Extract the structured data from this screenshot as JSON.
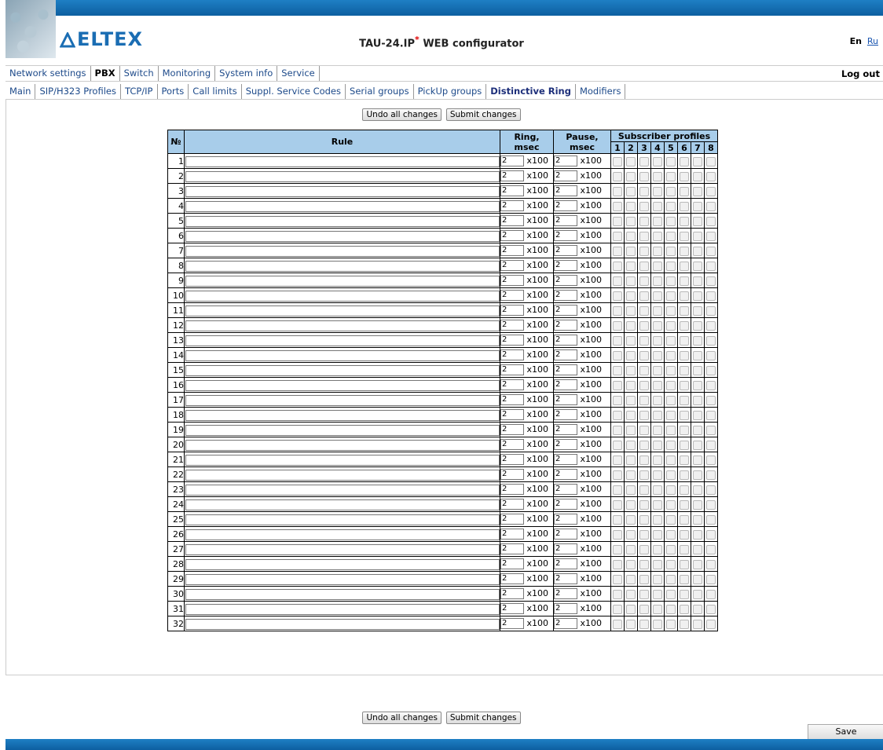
{
  "header": {
    "logo_text": "ELTEX",
    "title": "TAU-24.IP",
    "title_mark": "*",
    "title_suffix": " WEB configurator",
    "lang_en": "En",
    "lang_ru": "Ru"
  },
  "menu": {
    "items": [
      "Network settings",
      "PBX",
      "Switch",
      "Monitoring",
      "System info",
      "Service"
    ],
    "logout": "Log out"
  },
  "submenu": {
    "items": [
      "Main",
      "SIP/H323 Profiles",
      "TCP/IP",
      "Ports",
      "Call limits",
      "Suppl. Service Codes",
      "Serial groups",
      "PickUp groups",
      "Distinctive Ring",
      "Modifiers"
    ]
  },
  "buttons": {
    "undo": "Undo all changes",
    "submit": "Submit changes",
    "save": "Save"
  },
  "table": {
    "col_num": "№",
    "col_rule": "Rule",
    "col_ring": "Ring, msec",
    "col_pause": "Pause, msec",
    "col_profiles": "Subscriber profiles",
    "profile_numbers": [
      "1",
      "2",
      "3",
      "4",
      "5",
      "6",
      "7",
      "8"
    ],
    "multiplier": "x100",
    "rows": [
      {
        "n": "1",
        "ring": "2",
        "pause": "2"
      },
      {
        "n": "2",
        "ring": "2",
        "pause": "2"
      },
      {
        "n": "3",
        "ring": "2",
        "pause": "2"
      },
      {
        "n": "4",
        "ring": "2",
        "pause": "2"
      },
      {
        "n": "5",
        "ring": "2",
        "pause": "2"
      },
      {
        "n": "6",
        "ring": "2",
        "pause": "2"
      },
      {
        "n": "7",
        "ring": "2",
        "pause": "2"
      },
      {
        "n": "8",
        "ring": "2",
        "pause": "2"
      },
      {
        "n": "9",
        "ring": "2",
        "pause": "2"
      },
      {
        "n": "10",
        "ring": "2",
        "pause": "2"
      },
      {
        "n": "11",
        "ring": "2",
        "pause": "2"
      },
      {
        "n": "12",
        "ring": "2",
        "pause": "2"
      },
      {
        "n": "13",
        "ring": "2",
        "pause": "2"
      },
      {
        "n": "14",
        "ring": "2",
        "pause": "2"
      },
      {
        "n": "15",
        "ring": "2",
        "pause": "2"
      },
      {
        "n": "16",
        "ring": "2",
        "pause": "2"
      },
      {
        "n": "17",
        "ring": "2",
        "pause": "2"
      },
      {
        "n": "18",
        "ring": "2",
        "pause": "2"
      },
      {
        "n": "19",
        "ring": "2",
        "pause": "2"
      },
      {
        "n": "20",
        "ring": "2",
        "pause": "2"
      },
      {
        "n": "21",
        "ring": "2",
        "pause": "2"
      },
      {
        "n": "22",
        "ring": "2",
        "pause": "2"
      },
      {
        "n": "23",
        "ring": "2",
        "pause": "2"
      },
      {
        "n": "24",
        "ring": "2",
        "pause": "2"
      },
      {
        "n": "25",
        "ring": "2",
        "pause": "2"
      },
      {
        "n": "26",
        "ring": "2",
        "pause": "2"
      },
      {
        "n": "27",
        "ring": "2",
        "pause": "2"
      },
      {
        "n": "28",
        "ring": "2",
        "pause": "2"
      },
      {
        "n": "29",
        "ring": "2",
        "pause": "2"
      },
      {
        "n": "30",
        "ring": "2",
        "pause": "2"
      },
      {
        "n": "31",
        "ring": "2",
        "pause": "2"
      },
      {
        "n": "32",
        "ring": "2",
        "pause": "2"
      }
    ]
  }
}
